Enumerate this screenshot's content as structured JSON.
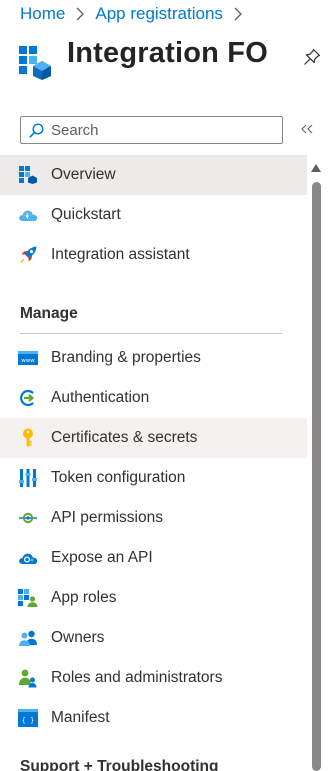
{
  "breadcrumb": {
    "items": [
      "Home",
      "App registrations"
    ]
  },
  "header": {
    "title": "Integration FO"
  },
  "search": {
    "placeholder": "Search"
  },
  "nav": {
    "top_items": [
      {
        "label": "Overview",
        "icon": "overview-icon",
        "selected": true
      },
      {
        "label": "Quickstart",
        "icon": "quickstart-cloud-icon"
      },
      {
        "label": "Integration assistant",
        "icon": "rocket-icon"
      }
    ],
    "manage": {
      "header": "Manage",
      "items": [
        {
          "label": "Branding & properties",
          "icon": "branding-icon"
        },
        {
          "label": "Authentication",
          "icon": "authentication-icon"
        },
        {
          "label": "Certificates & secrets",
          "icon": "key-icon",
          "hovered": true
        },
        {
          "label": "Token configuration",
          "icon": "token-configuration-icon"
        },
        {
          "label": "API permissions",
          "icon": "api-permissions-icon"
        },
        {
          "label": "Expose an API",
          "icon": "expose-api-cloud-icon"
        },
        {
          "label": "App roles",
          "icon": "app-roles-icon"
        },
        {
          "label": "Owners",
          "icon": "owners-icon"
        },
        {
          "label": "Roles and administrators",
          "icon": "roles-administrators-icon"
        },
        {
          "label": "Manifest",
          "icon": "manifest-icon"
        }
      ]
    },
    "support": {
      "header": "Support + Troubleshooting"
    }
  },
  "colors": {
    "link": "#0078d4",
    "selected_bg": "#edebe9",
    "hover_bg": "#f3f2f1",
    "text": "#323130"
  }
}
